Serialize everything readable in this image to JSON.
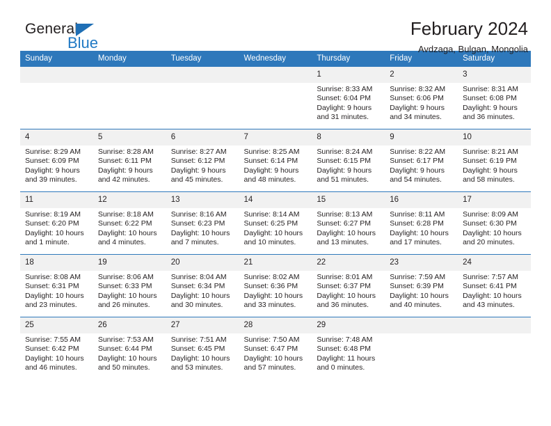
{
  "brand": {
    "name_top": "General",
    "name_bottom": "Blue",
    "accent_color": "#2079c4"
  },
  "header": {
    "title": "February 2024",
    "subtitle": "Avdzaga, Bulgan, Mongolia"
  },
  "theme": {
    "header_row_color": "#2e78bb",
    "daynum_band_color": "#f1f1f1",
    "text_color": "#231f20"
  },
  "weekdays": [
    "Sunday",
    "Monday",
    "Tuesday",
    "Wednesday",
    "Thursday",
    "Friday",
    "Saturday"
  ],
  "weeks": [
    [
      {
        "day": "",
        "lines": []
      },
      {
        "day": "",
        "lines": []
      },
      {
        "day": "",
        "lines": []
      },
      {
        "day": "",
        "lines": []
      },
      {
        "day": "1",
        "lines": [
          "Sunrise: 8:33 AM",
          "Sunset: 6:04 PM",
          "Daylight: 9 hours",
          "and 31 minutes."
        ]
      },
      {
        "day": "2",
        "lines": [
          "Sunrise: 8:32 AM",
          "Sunset: 6:06 PM",
          "Daylight: 9 hours",
          "and 34 minutes."
        ]
      },
      {
        "day": "3",
        "lines": [
          "Sunrise: 8:31 AM",
          "Sunset: 6:08 PM",
          "Daylight: 9 hours",
          "and 36 minutes."
        ]
      }
    ],
    [
      {
        "day": "4",
        "lines": [
          "Sunrise: 8:29 AM",
          "Sunset: 6:09 PM",
          "Daylight: 9 hours",
          "and 39 minutes."
        ]
      },
      {
        "day": "5",
        "lines": [
          "Sunrise: 8:28 AM",
          "Sunset: 6:11 PM",
          "Daylight: 9 hours",
          "and 42 minutes."
        ]
      },
      {
        "day": "6",
        "lines": [
          "Sunrise: 8:27 AM",
          "Sunset: 6:12 PM",
          "Daylight: 9 hours",
          "and 45 minutes."
        ]
      },
      {
        "day": "7",
        "lines": [
          "Sunrise: 8:25 AM",
          "Sunset: 6:14 PM",
          "Daylight: 9 hours",
          "and 48 minutes."
        ]
      },
      {
        "day": "8",
        "lines": [
          "Sunrise: 8:24 AM",
          "Sunset: 6:15 PM",
          "Daylight: 9 hours",
          "and 51 minutes."
        ]
      },
      {
        "day": "9",
        "lines": [
          "Sunrise: 8:22 AM",
          "Sunset: 6:17 PM",
          "Daylight: 9 hours",
          "and 54 minutes."
        ]
      },
      {
        "day": "10",
        "lines": [
          "Sunrise: 8:21 AM",
          "Sunset: 6:19 PM",
          "Daylight: 9 hours",
          "and 58 minutes."
        ]
      }
    ],
    [
      {
        "day": "11",
        "lines": [
          "Sunrise: 8:19 AM",
          "Sunset: 6:20 PM",
          "Daylight: 10 hours",
          "and 1 minute."
        ]
      },
      {
        "day": "12",
        "lines": [
          "Sunrise: 8:18 AM",
          "Sunset: 6:22 PM",
          "Daylight: 10 hours",
          "and 4 minutes."
        ]
      },
      {
        "day": "13",
        "lines": [
          "Sunrise: 8:16 AM",
          "Sunset: 6:23 PM",
          "Daylight: 10 hours",
          "and 7 minutes."
        ]
      },
      {
        "day": "14",
        "lines": [
          "Sunrise: 8:14 AM",
          "Sunset: 6:25 PM",
          "Daylight: 10 hours",
          "and 10 minutes."
        ]
      },
      {
        "day": "15",
        "lines": [
          "Sunrise: 8:13 AM",
          "Sunset: 6:27 PM",
          "Daylight: 10 hours",
          "and 13 minutes."
        ]
      },
      {
        "day": "16",
        "lines": [
          "Sunrise: 8:11 AM",
          "Sunset: 6:28 PM",
          "Daylight: 10 hours",
          "and 17 minutes."
        ]
      },
      {
        "day": "17",
        "lines": [
          "Sunrise: 8:09 AM",
          "Sunset: 6:30 PM",
          "Daylight: 10 hours",
          "and 20 minutes."
        ]
      }
    ],
    [
      {
        "day": "18",
        "lines": [
          "Sunrise: 8:08 AM",
          "Sunset: 6:31 PM",
          "Daylight: 10 hours",
          "and 23 minutes."
        ]
      },
      {
        "day": "19",
        "lines": [
          "Sunrise: 8:06 AM",
          "Sunset: 6:33 PM",
          "Daylight: 10 hours",
          "and 26 minutes."
        ]
      },
      {
        "day": "20",
        "lines": [
          "Sunrise: 8:04 AM",
          "Sunset: 6:34 PM",
          "Daylight: 10 hours",
          "and 30 minutes."
        ]
      },
      {
        "day": "21",
        "lines": [
          "Sunrise: 8:02 AM",
          "Sunset: 6:36 PM",
          "Daylight: 10 hours",
          "and 33 minutes."
        ]
      },
      {
        "day": "22",
        "lines": [
          "Sunrise: 8:01 AM",
          "Sunset: 6:37 PM",
          "Daylight: 10 hours",
          "and 36 minutes."
        ]
      },
      {
        "day": "23",
        "lines": [
          "Sunrise: 7:59 AM",
          "Sunset: 6:39 PM",
          "Daylight: 10 hours",
          "and 40 minutes."
        ]
      },
      {
        "day": "24",
        "lines": [
          "Sunrise: 7:57 AM",
          "Sunset: 6:41 PM",
          "Daylight: 10 hours",
          "and 43 minutes."
        ]
      }
    ],
    [
      {
        "day": "25",
        "lines": [
          "Sunrise: 7:55 AM",
          "Sunset: 6:42 PM",
          "Daylight: 10 hours",
          "and 46 minutes."
        ]
      },
      {
        "day": "26",
        "lines": [
          "Sunrise: 7:53 AM",
          "Sunset: 6:44 PM",
          "Daylight: 10 hours",
          "and 50 minutes."
        ]
      },
      {
        "day": "27",
        "lines": [
          "Sunrise: 7:51 AM",
          "Sunset: 6:45 PM",
          "Daylight: 10 hours",
          "and 53 minutes."
        ]
      },
      {
        "day": "28",
        "lines": [
          "Sunrise: 7:50 AM",
          "Sunset: 6:47 PM",
          "Daylight: 10 hours",
          "and 57 minutes."
        ]
      },
      {
        "day": "29",
        "lines": [
          "Sunrise: 7:48 AM",
          "Sunset: 6:48 PM",
          "Daylight: 11 hours",
          "and 0 minutes."
        ]
      },
      {
        "day": "",
        "lines": []
      },
      {
        "day": "",
        "lines": []
      }
    ]
  ]
}
